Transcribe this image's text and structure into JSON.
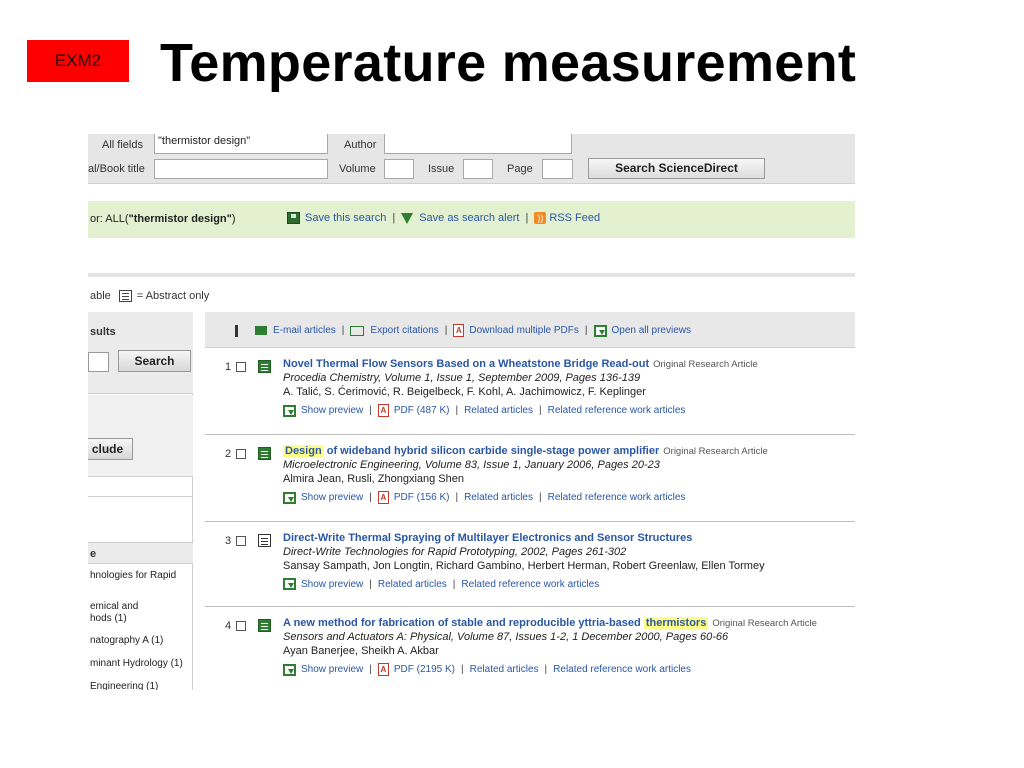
{
  "slide": {
    "badge": "EXM2",
    "title": "Temperature measurement"
  },
  "search_form": {
    "all_fields_label": "All fields",
    "all_fields_value": "\"thermistor design\"",
    "author_label": "Author",
    "journal_label": "al/Book title",
    "volume_label": "Volume",
    "issue_label": "Issue",
    "page_label": "Page",
    "search_button": "Search ScienceDirect"
  },
  "query_bar": {
    "prefix": "or: ALL(",
    "query": "\"thermistor design\"",
    "suffix": ")",
    "save_search": "Save this search",
    "save_alert": "Save as search alert",
    "rss": "RSS Feed"
  },
  "legend": {
    "prefix": "able",
    "abstract_only": "= Abstract only"
  },
  "sidebar": {
    "refine_heading": "sults",
    "search_button": "Search",
    "exclude_button": "clude",
    "source_heading": "e",
    "items": [
      "hnologies for Rapid",
      "emical and",
      "hods (1)",
      "natography A (1)",
      "minant Hydrology (1)",
      "Engineering (1)"
    ]
  },
  "toolbar": {
    "email": "E-mail articles",
    "export": "Export citations",
    "download": "Download multiple PDFs",
    "previews": "Open all previews"
  },
  "results": [
    {
      "num": "1",
      "title": "Novel Thermal Flow Sensors Based on a Wheatstone Bridge Read-out",
      "type": "Original Research Article",
      "source": "Procedia Chemistry, Volume 1, Issue 1, September 2009, Pages 136-139",
      "authors": "A. Talić, S. Ćerimović, R. Beigelbeck, F. Kohl, A. Jachimowicz, F. Keplinger",
      "preview": "Show preview",
      "pdf": "PDF (487 K)",
      "related": "Related articles",
      "related_ref": "Related reference work articles"
    },
    {
      "num": "2",
      "title_highlight": "Design",
      "title_rest": " of wideband hybrid silicon carbide single-stage power amplifier",
      "type": "Original Research Article",
      "source": "Microelectronic Engineering, Volume 83, Issue 1, January 2006, Pages 20-23",
      "authors": "Almira Jean, Rusli, Zhongxiang Shen",
      "preview": "Show preview",
      "pdf": "PDF (156 K)",
      "related": "Related articles",
      "related_ref": "Related reference work articles"
    },
    {
      "num": "3",
      "title": "Direct-Write Thermal Spraying of Multilayer Electronics and Sensor Structures",
      "source": "Direct-Write Technologies for Rapid Prototyping, 2002, Pages 261-302",
      "authors": "Sansay Sampath, Jon Longtin, Richard Gambino, Herbert Herman, Robert Greenlaw, Ellen Tormey",
      "preview": "Show preview",
      "related": "Related articles",
      "related_ref": "Related reference work articles"
    },
    {
      "num": "4",
      "title_rest": "A new method for fabrication of stable and reproducible yttria-based ",
      "title_highlight": "thermistors",
      "type": "Original Research Article",
      "source": "Sensors and Actuators A: Physical, Volume 87, Issues 1-2, 1 December 2000, Pages 60-66",
      "authors": "Ayan Banerjee, Sheikh A. Akbar",
      "preview": "Show preview",
      "pdf": "PDF (2195 K)",
      "related": "Related articles",
      "related_ref": "Related reference work articles"
    }
  ]
}
